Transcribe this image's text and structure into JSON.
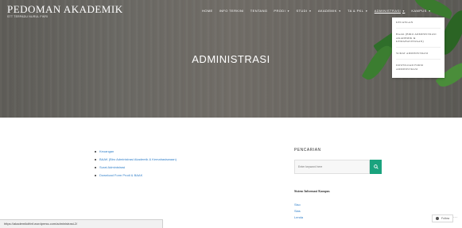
{
  "header": {
    "site_title": "PEDOMAN AKADEMIK",
    "site_tagline": "STT TERPADU NURUL FIKRI"
  },
  "nav": {
    "items": [
      {
        "label": "HOME",
        "has_caret": false
      },
      {
        "label": "INFO TERKINI",
        "has_caret": false
      },
      {
        "label": "TENTANG",
        "has_caret": false
      },
      {
        "label": "PRODI",
        "has_caret": true
      },
      {
        "label": "STUDI",
        "has_caret": true
      },
      {
        "label": "AKADEMIK",
        "has_caret": true
      },
      {
        "label": "TA & PKL",
        "has_caret": true
      },
      {
        "label": "ADMINISTRASI",
        "has_caret": true
      },
      {
        "label": "KAMPUS",
        "has_caret": true
      }
    ]
  },
  "dropdown": {
    "items": [
      "KEUANGAN",
      "BAAK (BIRO ADMINISTRASI AKADEMIK & KEMAHASISWAAN)",
      "SURAT ADMINISTRASI",
      "DOWNLOAD FORM ADMINISTRASI"
    ]
  },
  "page": {
    "title": "ADMINISTRASI"
  },
  "content": {
    "links": [
      "Keuangan",
      "BAAK (Biro Administrasi Akademik & Kemahasiswaan)",
      "Surat Administrasi",
      "Download Form Prodi & BAAK"
    ]
  },
  "sidebar": {
    "search_title": "PENCARIAN",
    "search_placeholder": "Enter keyword here",
    "info_heading": "Sistem Informasi Kampus",
    "info_links": [
      "Siso",
      "Sias",
      "Lenda"
    ]
  },
  "status_bar": {
    "url": "https://akademikdttnf.wordpress.com/administrasi-2/"
  },
  "follow": {
    "label": "Follow"
  },
  "colors": {
    "accent": "#1aa37e",
    "link": "#2e7ec9"
  }
}
